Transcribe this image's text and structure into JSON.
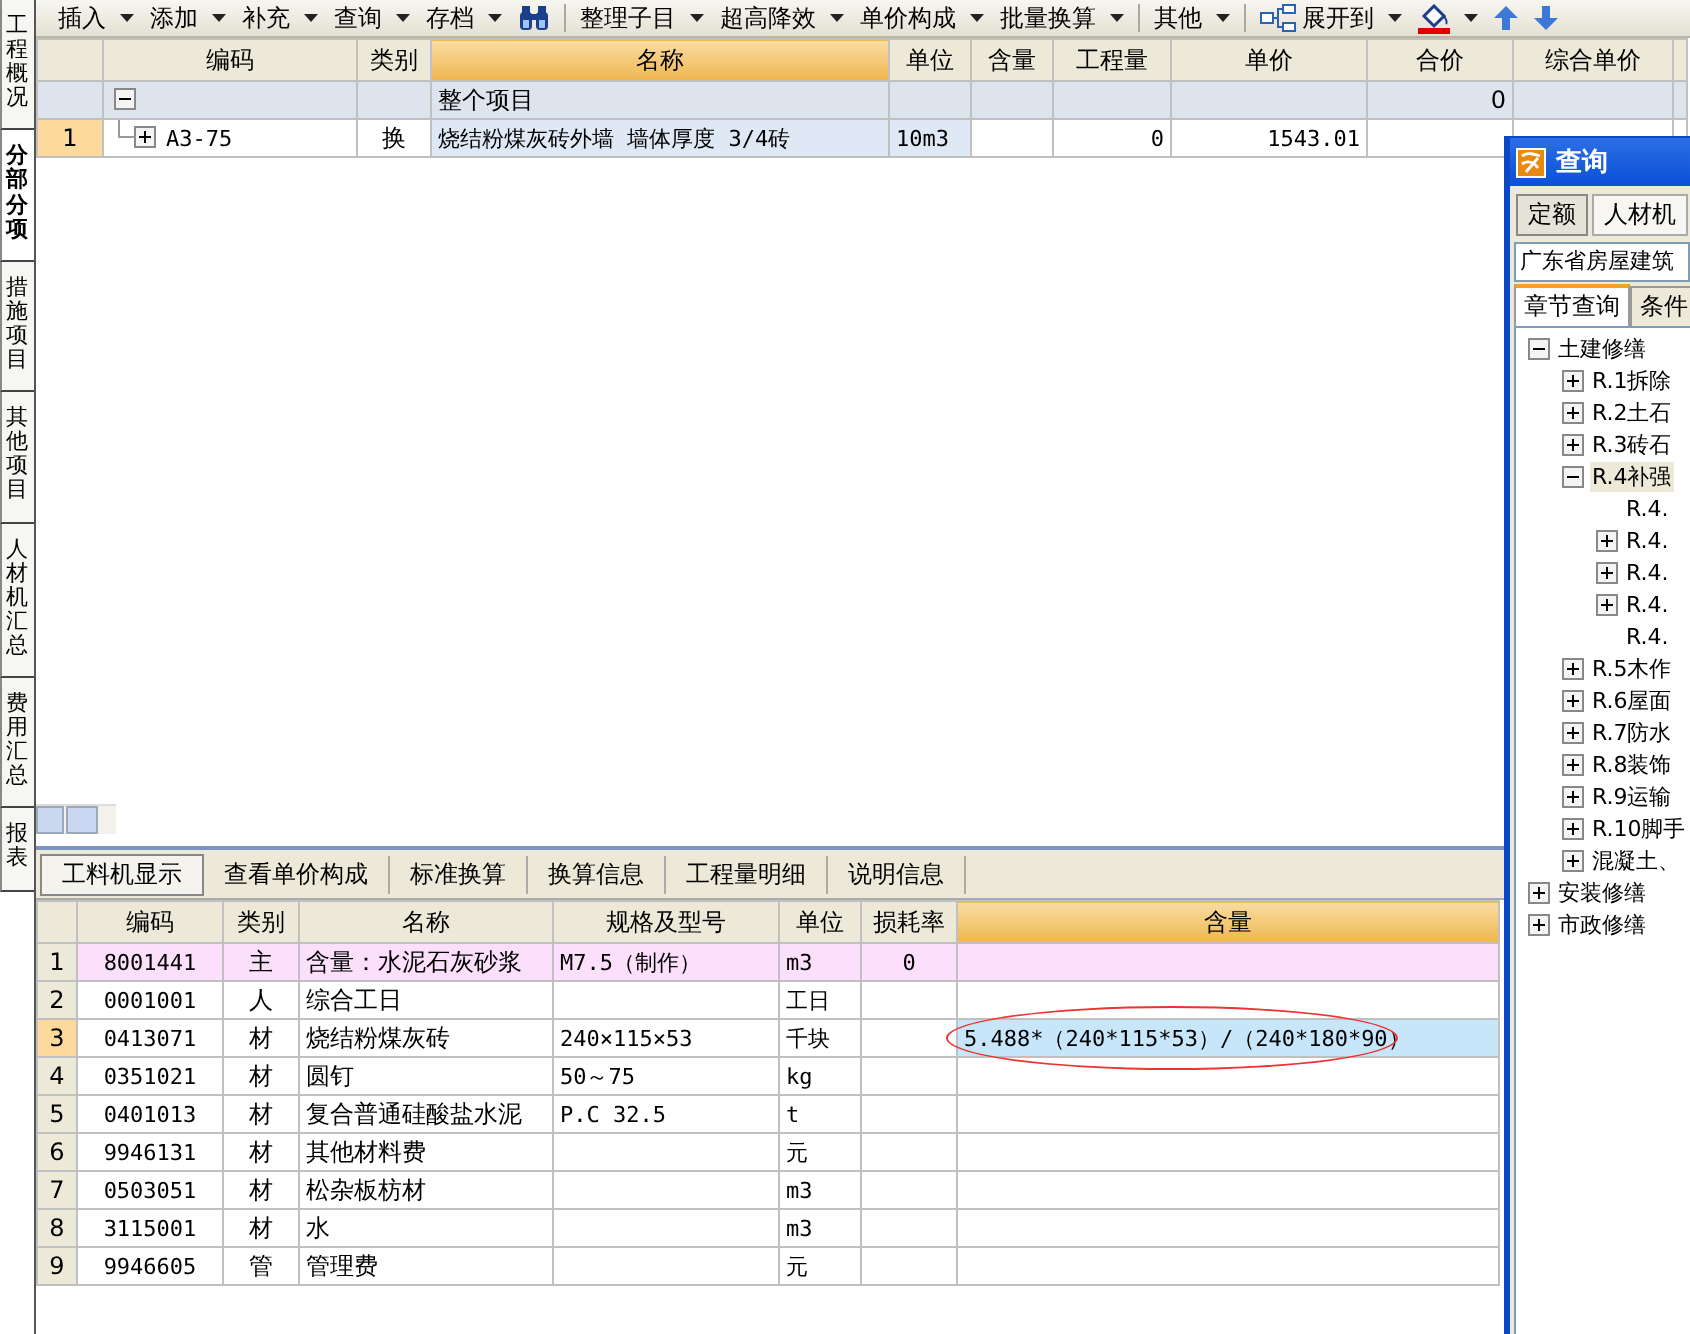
{
  "side_tabs": [
    {
      "label": "工程概况",
      "selected": false
    },
    {
      "label": "分部分项",
      "selected": true
    },
    {
      "label": "措施项目",
      "selected": false
    },
    {
      "label": "其他项目",
      "selected": false
    },
    {
      "label": "人材机汇总",
      "selected": false
    },
    {
      "label": "费用汇总",
      "selected": false
    },
    {
      "label": "报表",
      "selected": false
    }
  ],
  "toolbar": [
    {
      "kind": "menu",
      "label": "插入"
    },
    {
      "kind": "menu",
      "label": "添加"
    },
    {
      "kind": "menu",
      "label": "补充"
    },
    {
      "kind": "menu",
      "label": "查询"
    },
    {
      "kind": "menu",
      "label": "存档"
    },
    {
      "kind": "find"
    },
    {
      "kind": "separator"
    },
    {
      "kind": "menu",
      "label": "整理子目"
    },
    {
      "kind": "menu",
      "label": "超高降效"
    },
    {
      "kind": "menu",
      "label": "单价构成"
    },
    {
      "kind": "menu",
      "label": "批量换算"
    },
    {
      "kind": "separator"
    },
    {
      "kind": "menu",
      "label": "其他"
    },
    {
      "kind": "separator"
    },
    {
      "kind": "expand",
      "label": "展开到"
    },
    {
      "kind": "fill"
    },
    {
      "kind": "up"
    },
    {
      "kind": "down"
    }
  ],
  "upper_grid": {
    "columns": [
      {
        "label": "编码",
        "selected": false
      },
      {
        "label": "类别",
        "selected": false
      },
      {
        "label": "名称",
        "selected": true
      },
      {
        "label": "单位",
        "selected": false
      },
      {
        "label": "含量",
        "selected": false
      },
      {
        "label": "工程量",
        "selected": false
      },
      {
        "label": "单价",
        "selected": false
      },
      {
        "label": "合价",
        "selected": false
      },
      {
        "label": "综合单价",
        "selected": false
      }
    ],
    "rows": [
      {
        "kind": "group",
        "expanded": true,
        "name": "整个项目",
        "total": "0"
      },
      {
        "kind": "item",
        "number": "1",
        "selected": true,
        "expanded": false,
        "code": "A3-75",
        "type": "换",
        "name": "烧结粉煤灰砖外墙 墙体厚度 3/4砖",
        "unit": "10m3",
        "quantity": "0",
        "unit_price": "1543.01"
      }
    ]
  },
  "lower_tabs": [
    {
      "label": "工料机显示",
      "selected": true
    },
    {
      "label": "查看单价构成",
      "selected": false
    },
    {
      "label": "标准换算",
      "selected": false
    },
    {
      "label": "换算信息",
      "selected": false
    },
    {
      "label": "工程量明细",
      "selected": false
    },
    {
      "label": "说明信息",
      "selected": false
    }
  ],
  "lower_grid": {
    "columns": [
      {
        "label": "编码",
        "selected": false
      },
      {
        "label": "类别",
        "selected": false
      },
      {
        "label": "名称",
        "selected": false
      },
      {
        "label": "规格及型号",
        "selected": false
      },
      {
        "label": "单位",
        "selected": false
      },
      {
        "label": "损耗率",
        "selected": false
      },
      {
        "label": "含量",
        "selected": true
      }
    ],
    "rows": [
      {
        "number": "1",
        "code": "8001441",
        "type": "主",
        "name": "含量：水泥石灰砂浆",
        "spec": "M7.5（制作）",
        "unit": "m3",
        "loss_rate": "0",
        "highlighted": true,
        "selected": false,
        "circled": false
      },
      {
        "number": "2",
        "code": "0001001",
        "type": "人",
        "name": "综合工日",
        "unit": "工日",
        "highlighted": false,
        "selected": false,
        "circled": false
      },
      {
        "number": "3",
        "code": "0413071",
        "type": "材",
        "name": "烧结粉煤灰砖",
        "spec": "240×115×53",
        "unit": "千块",
        "content": "5.488*（240*115*53）/（240*180*90）",
        "highlighted": false,
        "selected": true,
        "circled": true
      },
      {
        "number": "4",
        "code": "0351021",
        "type": "材",
        "name": "圆钉",
        "spec": "50～75",
        "unit": "kg",
        "highlighted": false,
        "selected": false,
        "circled": false
      },
      {
        "number": "5",
        "code": "0401013",
        "type": "材",
        "name": "复合普通硅酸盐水泥",
        "spec": "P.C 32.5",
        "unit": "t",
        "highlighted": false,
        "selected": false,
        "circled": false
      },
      {
        "number": "6",
        "code": "9946131",
        "type": "材",
        "name": "其他材料费",
        "unit": "元",
        "highlighted": false,
        "selected": false,
        "circled": false
      },
      {
        "number": "7",
        "code": "0503051",
        "type": "材",
        "name": "松杂板枋材",
        "unit": "m3",
        "highlighted": false,
        "selected": false,
        "circled": false
      },
      {
        "number": "8",
        "code": "3115001",
        "type": "材",
        "name": "水",
        "unit": "m3",
        "highlighted": false,
        "selected": false,
        "circled": false
      },
      {
        "number": "9",
        "code": "9946605",
        "type": "管",
        "name": "管理费",
        "unit": "元",
        "highlighted": false,
        "selected": false,
        "circled": false
      }
    ]
  },
  "query_window": {
    "title": "查询",
    "tabs": [
      {
        "label": "定额",
        "selected": true
      },
      {
        "label": "人材机",
        "selected": false
      }
    ],
    "library": "广东省房屋建筑",
    "subtabs": [
      {
        "label": "章节查询",
        "selected": true
      },
      {
        "label": "条件",
        "selected": false
      }
    ],
    "tree": [
      {
        "label": "土建修缮",
        "expanded": true,
        "selected": false,
        "children": [
          {
            "label": "R.1拆除",
            "expanded": false,
            "selected": false
          },
          {
            "label": "R.2土石",
            "expanded": false,
            "selected": false
          },
          {
            "label": "R.3砖石",
            "expanded": false,
            "selected": false
          },
          {
            "label": "R.4补强",
            "expanded": true,
            "selected": true,
            "children": [
              {
                "label": "R.4.",
                "selected": false
              },
              {
                "label": "R.4.",
                "expanded": false,
                "selected": false
              },
              {
                "label": "R.4.",
                "expanded": false,
                "selected": false
              },
              {
                "label": "R.4.",
                "expanded": false,
                "selected": false
              },
              {
                "label": "R.4.",
                "selected": false
              }
            ]
          },
          {
            "label": "R.5木作",
            "expanded": false,
            "selected": false
          },
          {
            "label": "R.6屋面",
            "expanded": false,
            "selected": false
          },
          {
            "label": "R.7防水",
            "expanded": false,
            "selected": false
          },
          {
            "label": "R.8装饰",
            "expanded": false,
            "selected": false
          },
          {
            "label": "R.9运输",
            "expanded": false,
            "selected": false
          },
          {
            "label": "R.10脚手",
            "expanded": false,
            "selected": false
          },
          {
            "label": "混凝土、",
            "expanded": false,
            "selected": false
          }
        ]
      },
      {
        "label": "安装修缮",
        "expanded": false,
        "selected": false
      },
      {
        "label": "市政修缮",
        "expanded": false,
        "selected": false
      }
    ]
  }
}
